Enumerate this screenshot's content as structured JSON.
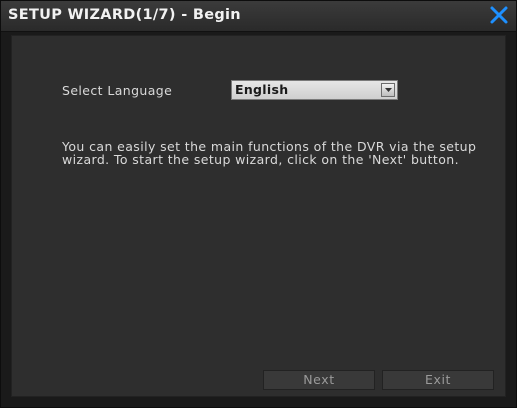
{
  "window": {
    "title": "SETUP WIZARD(1/7) - Begin",
    "close_icon": "close-icon",
    "accent_color": "#1e90ff"
  },
  "language": {
    "label": "Select Language",
    "selected": "English",
    "dropdown_icon": "chevron-down-icon"
  },
  "description": "You can easily set the main functions of the DVR via the setup wizard. To start the setup wizard, click on the 'Next' button.",
  "buttons": {
    "next_label": "Next",
    "exit_label": "Exit"
  }
}
